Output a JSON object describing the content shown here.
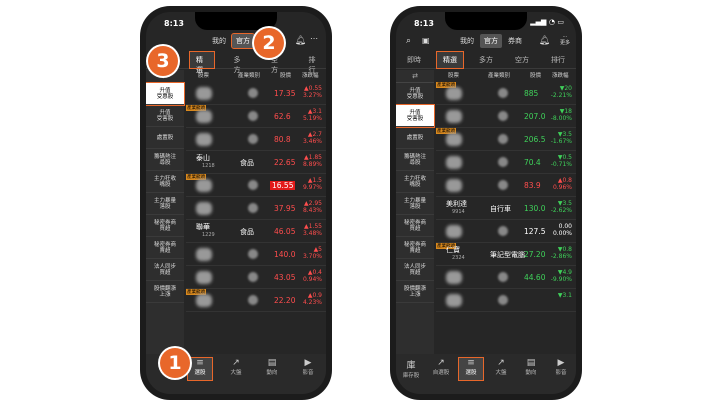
{
  "left": {
    "time": "8:13",
    "top_tabs": [
      "我的",
      "官方"
    ],
    "sub_tabs": [
      "精選",
      "多方",
      "空方",
      "排行"
    ],
    "columns": [
      "股票",
      "產業類別",
      "股價",
      "漲跌幅"
    ],
    "sidebar_items": [
      "升值\n受惠股",
      "升值\n受害股",
      "處置股",
      "籌碼熱注\n尋股",
      "主力狂收\n嘴股",
      "主力暴量\n落股",
      "秘密券商\n買超",
      "秘密券商\n賣超",
      "法人同步\n買超",
      "股價翻漲\n上漲"
    ],
    "rows": [
      {
        "name": "",
        "code": "",
        "cat": "",
        "price": "17.35",
        "chg1": "▲0.55",
        "chg2": "3.27%",
        "dir": "up"
      },
      {
        "name": "",
        "code": "",
        "cat": "",
        "badge": "產業龍頭",
        "price": "62.6",
        "chg1": "▲3.1",
        "chg2": "5.19%",
        "dir": "up"
      },
      {
        "name": "",
        "code": "",
        "cat": "",
        "price": "80.8",
        "chg1": "▲2.7",
        "chg2": "3.46%",
        "dir": "up"
      },
      {
        "name": "泰山",
        "code": "1218",
        "cat": "食品",
        "price": "22.65",
        "chg1": "▲1.85",
        "chg2": "8.89%",
        "dir": "up"
      },
      {
        "name": "",
        "code": "",
        "cat": "",
        "badge": "產業龍頭",
        "price": "16.55",
        "chg1": "▲1.5",
        "chg2": "9.97%",
        "dir": "up",
        "hl": true
      },
      {
        "name": "",
        "code": "",
        "cat": "",
        "price": "37.95",
        "chg1": "▲2.95",
        "chg2": "8.43%",
        "dir": "up"
      },
      {
        "name": "聯華",
        "code": "1229",
        "cat": "食品",
        "price": "46.05",
        "chg1": "▲1.55",
        "chg2": "3.48%",
        "dir": "up"
      },
      {
        "name": "",
        "code": "",
        "cat": "",
        "price": "140.0",
        "chg1": "▲5",
        "chg2": "3.70%",
        "dir": "up"
      },
      {
        "name": "",
        "code": "",
        "cat": "",
        "price": "43.05",
        "chg1": "▲0.4",
        "chg2": "0.94%",
        "dir": "up"
      },
      {
        "name": "",
        "code": "",
        "cat": "",
        "badge": "產業龍頭",
        "price": "22.20",
        "chg1": "▲0.9",
        "chg2": "4.23%",
        "dir": "up"
      }
    ],
    "nav": [
      {
        "icon": "庫",
        "label": ""
      },
      {
        "icon": "≡",
        "label": "選股"
      },
      {
        "icon": "↗",
        "label": "大盤"
      },
      {
        "icon": "▤",
        "label": "動向"
      },
      {
        "icon": "▶",
        "label": "影音"
      }
    ]
  },
  "right": {
    "time": "8:13",
    "top_tabs": [
      "我的",
      "官方",
      "券商"
    ],
    "more_label": "更多",
    "sub_tabs": [
      "即時",
      "精選",
      "多方",
      "空方",
      "排行"
    ],
    "columns": [
      "股票",
      "產業類別",
      "股價",
      "漲跌幅"
    ],
    "sidebar_items": [
      "升值\n受惠股",
      "升值\n受害股",
      "處置股",
      "籌碼熱注\n尋股",
      "主力狂收\n嘴股",
      "主力暴量\n落股",
      "秘密券商\n買超",
      "秘密券商\n賣超",
      "法人同步\n買超",
      "股價翻漲\n上漲"
    ],
    "rows": [
      {
        "name": "",
        "code": "",
        "cat": "",
        "badge": "產業龍頭",
        "price": "885",
        "chg1": "▼20",
        "chg2": "-2.21%",
        "dir": "dn"
      },
      {
        "name": "",
        "code": "",
        "cat": "",
        "price": "207.0",
        "chg1": "▼18",
        "chg2": "-8.00%",
        "dir": "dn"
      },
      {
        "name": "",
        "code": "",
        "cat": "",
        "badge": "產業龍頭",
        "price": "206.5",
        "chg1": "▼3.5",
        "chg2": "-1.67%",
        "dir": "dn"
      },
      {
        "name": "",
        "code": "",
        "cat": "",
        "price": "70.4",
        "chg1": "▼0.5",
        "chg2": "-0.71%",
        "dir": "dn"
      },
      {
        "name": "",
        "code": "",
        "cat": "",
        "price": "83.9",
        "chg1": "▲0.8",
        "chg2": "0.96%",
        "dir": "up"
      },
      {
        "name": "美利達",
        "code": "9914",
        "cat": "自行車",
        "price": "130.0",
        "chg1": "▼3.5",
        "chg2": "-2.62%",
        "dir": "dn"
      },
      {
        "name": "",
        "code": "",
        "cat": "",
        "price": "127.5",
        "chg1": "0.00",
        "chg2": "0.00%",
        "dir": "fl"
      },
      {
        "name": "仁寶",
        "code": "2324",
        "cat": "筆記型電腦",
        "badge": "產業龍頭",
        "price": "27.20",
        "chg1": "▼0.8",
        "chg2": "-2.86%",
        "dir": "dn"
      },
      {
        "name": "",
        "code": "",
        "cat": "",
        "price": "44.60",
        "chg1": "▼4.9",
        "chg2": "-9.90%",
        "dir": "dn"
      },
      {
        "name": "",
        "code": "",
        "cat": "",
        "price": "",
        "chg1": "▼3.1",
        "chg2": "",
        "dir": "dn"
      }
    ],
    "nav": [
      {
        "icon": "庫",
        "label": "庫存股"
      },
      {
        "icon": "↗",
        "label": "自選股"
      },
      {
        "icon": "≡",
        "label": "選股"
      },
      {
        "icon": "↗",
        "label": "大盤"
      },
      {
        "icon": "▤",
        "label": "動向"
      },
      {
        "icon": "▶",
        "label": "影音"
      }
    ]
  },
  "steps": [
    "1",
    "2",
    "3"
  ],
  "colors": {
    "accent": "#e8672a",
    "up": "#ff4d4d",
    "down": "#3fd15a",
    "badge": "#d9891e"
  }
}
